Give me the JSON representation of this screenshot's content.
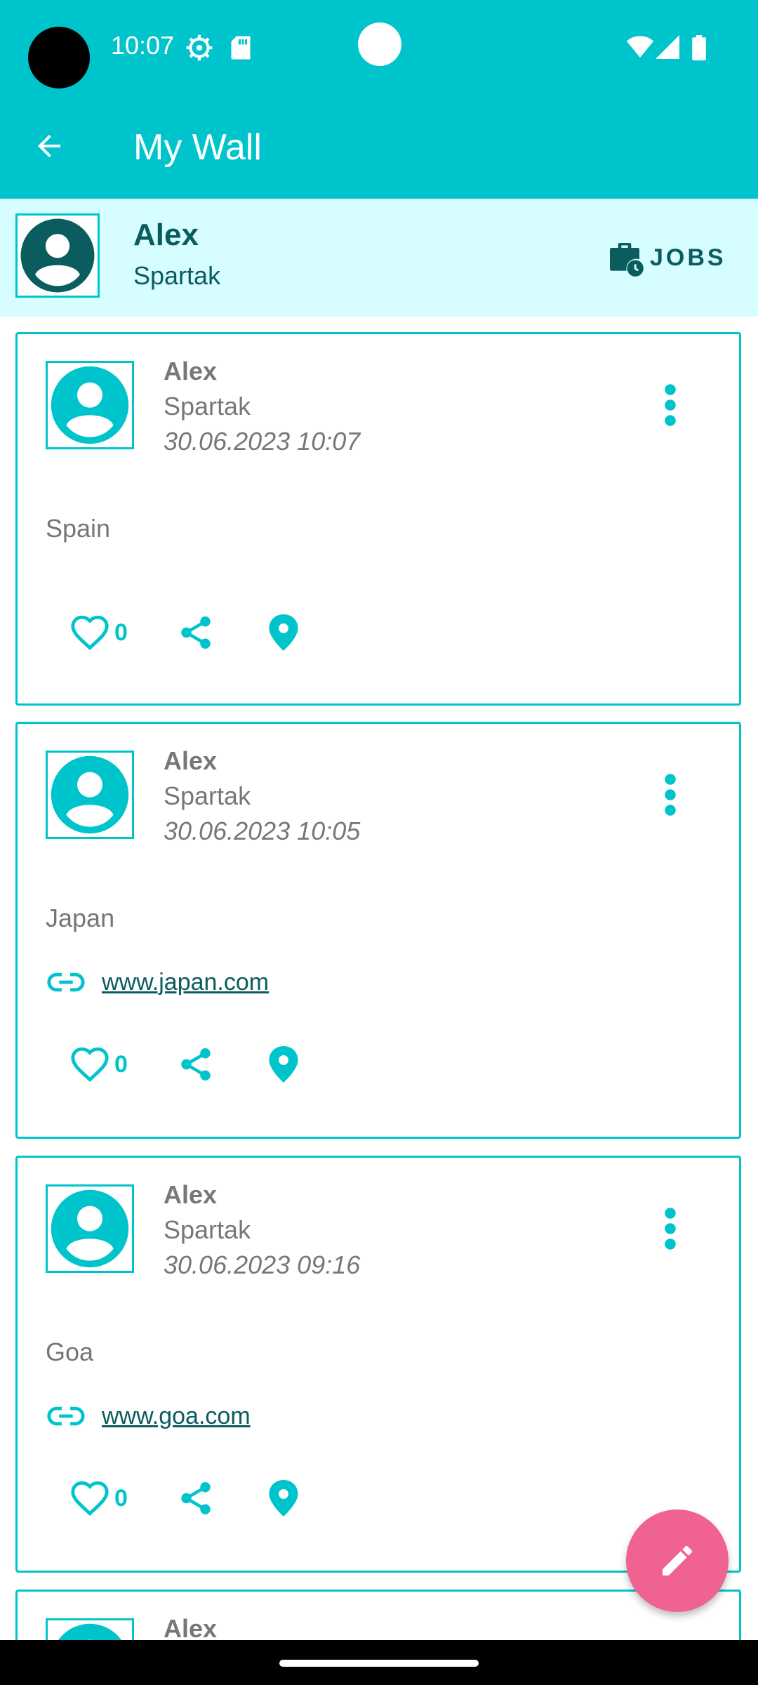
{
  "status_bar": {
    "time": "10:07"
  },
  "app_bar": {
    "title": "My Wall"
  },
  "profile": {
    "name": "Alex",
    "subtitle": "Spartak",
    "jobs_label": "JOBS"
  },
  "posts": [
    {
      "author": "Alex",
      "subtitle": "Spartak",
      "date": "30.06.2023 10:07",
      "text": "Spain",
      "likes": "0"
    },
    {
      "author": "Alex",
      "subtitle": "Spartak",
      "date": "30.06.2023 10:05",
      "text": "Japan",
      "link": "www.japan.com",
      "likes": "0"
    },
    {
      "author": "Alex",
      "subtitle": "Spartak",
      "date": "30.06.2023 09:16",
      "text": "Goa",
      "link": "www.goa.com",
      "likes": "0"
    },
    {
      "author": "Alex"
    }
  ],
  "colors": {
    "primary": "#00C4CC",
    "header_bg": "#D6FDFF",
    "dark_teal": "#0B5C5F",
    "fab": "#F06292"
  },
  "icons": [
    "back-arrow-icon",
    "gear-icon",
    "sd-card-icon",
    "wifi-icon",
    "signal-icon",
    "battery-icon",
    "briefcase-clock-icon",
    "more-vert-icon",
    "heart-outline-icon",
    "share-icon",
    "location-pin-icon",
    "link-icon",
    "pencil-icon"
  ]
}
